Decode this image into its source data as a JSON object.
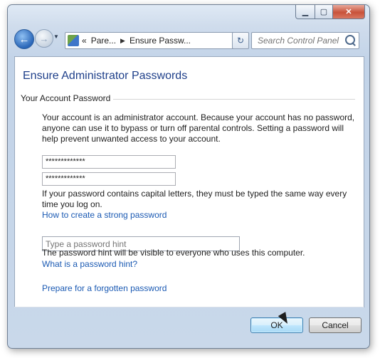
{
  "window": {
    "minimize": "▁",
    "maximize": "▢",
    "close": "✕"
  },
  "nav": {
    "back_icon": "←",
    "forward_icon": "→",
    "crumb_chevrons": "«",
    "crumb_parent": "Pare...",
    "crumb_current": "Ensure Passw...",
    "refresh_icon": "↻"
  },
  "search": {
    "placeholder": "Search Control Panel"
  },
  "page": {
    "title": "Ensure Administrator Passwords",
    "group_title": "Your Account Password",
    "intro": "Your account is an administrator account. Because your account has no password, anyone can use it to bypass or turn off parental controls. Setting a password will help prevent unwanted access to your account.",
    "password_value": "*************",
    "confirm_value": "*************",
    "case_note": "If your password contains capital letters, they must be typed the same way every time you log on.",
    "strong_link": "How to create a strong password",
    "hint_placeholder": "Type a password hint",
    "hint_note": "The password hint will be visible to everyone who uses this computer.",
    "hint_link": "What is a password hint?",
    "forgot_link": "Prepare for a forgotten password"
  },
  "buttons": {
    "ok": "OK",
    "cancel": "Cancel"
  }
}
